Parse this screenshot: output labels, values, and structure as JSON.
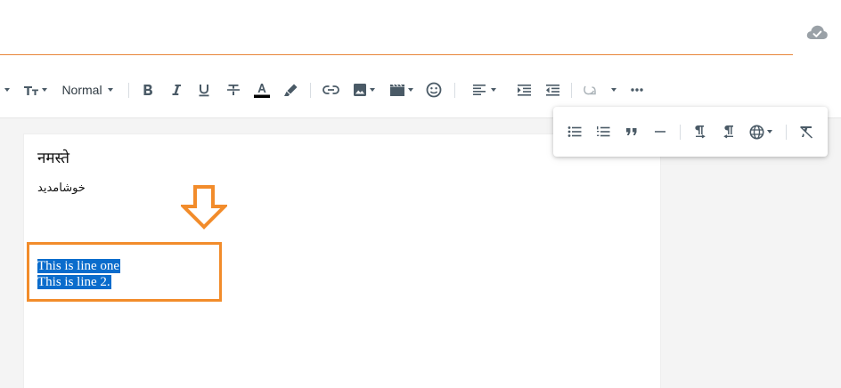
{
  "document": {
    "title_value": "",
    "sync_status_icon": "cloud-check-icon"
  },
  "toolbar": {
    "paragraph_format": "Normal",
    "icons": [
      "heading-icon",
      "font-size-icon",
      "bold-icon",
      "italic-icon",
      "underline-icon",
      "strikethrough-icon",
      "text-color-icon",
      "highlight-icon",
      "link-icon",
      "image-icon",
      "video-icon",
      "emoji-icon",
      "align-left-icon",
      "indent-icon",
      "outdent-icon",
      "special-char-icon",
      "more-icon"
    ],
    "text_color_swatch": "#000000"
  },
  "more_popup": {
    "icons": [
      "bullet-list-icon",
      "numbered-list-icon",
      "quote-icon",
      "horizontal-rule-icon",
      "ltr-icon",
      "rtl-icon",
      "language-icon",
      "clear-format-icon"
    ]
  },
  "content": {
    "hindi_line": "नमस्ते",
    "urdu_line": "خوشامدید",
    "selected_lines": [
      "This is line one",
      "This is line 2."
    ]
  },
  "annotation": {
    "color": "#f28c2b",
    "selection_color": "#0a6ccc"
  }
}
